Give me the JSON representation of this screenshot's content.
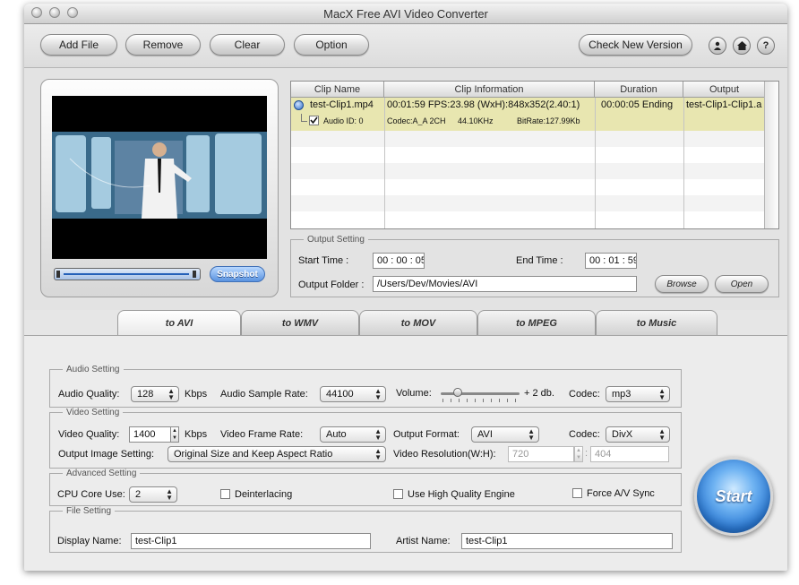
{
  "window": {
    "title": "MacX Free AVI Video Converter"
  },
  "toolbar": {
    "add_file": "Add File",
    "remove": "Remove",
    "clear": "Clear",
    "option": "Option",
    "check_version": "Check New Version",
    "icons": [
      "user-icon",
      "home-icon",
      "help-icon"
    ],
    "help_glyph": "?"
  },
  "preview": {
    "snapshot_label": "Snapshot"
  },
  "clips": {
    "headers": [
      "Clip Name",
      "Clip Information",
      "Duration",
      "Output"
    ],
    "rows": [
      {
        "name": "test-Clip1.mp4",
        "info": "00:01:59  FPS:23.98  (WxH):848x352(2.40:1)",
        "duration": "00:00:05 Ending",
        "output": "test-Clip1-Clip1.a",
        "audio_id": "Audio ID: 0",
        "codec": "Codec:A_A 2CH",
        "freq": "44.10KHz",
        "bitrate": "BitRate:127.99Kb"
      }
    ]
  },
  "output_setting": {
    "legend": "Output Setting",
    "start_label": "Start Time :",
    "start_value": "00 : 00 : 05",
    "end_label": "End Time :",
    "end_value": "00 : 01 : 59",
    "folder_label": "Output Folder :",
    "folder_value": "/Users/Dev/Movies/AVI",
    "browse": "Browse",
    "open": "Open"
  },
  "tabs": [
    "to AVI",
    "to WMV",
    "to MOV",
    "to MPEG",
    "to Music"
  ],
  "audio": {
    "legend": "Audio Setting",
    "quality_label": "Audio Quality:",
    "quality_value": "128",
    "quality_unit": "Kbps",
    "rate_label": "Audio Sample Rate:",
    "rate_value": "44100",
    "volume_label": "Volume:",
    "volume_value": "+ 2 db.",
    "codec_label": "Codec:",
    "codec_value": "mp3"
  },
  "video": {
    "legend": "Video Setting",
    "quality_label": "Video Quality:",
    "quality_value": "1400",
    "quality_unit": "Kbps",
    "frame_label": "Video Frame Rate:",
    "frame_value": "Auto",
    "format_label": "Output Format:",
    "format_value": "AVI",
    "codec_label": "Codec:",
    "codec_value": "DivX",
    "image_label": "Output Image Setting:",
    "image_value": "Original Size and Keep Aspect Ratio",
    "res_label": "Video Resolution(W:H):",
    "res_w": "720",
    "res_h": "404",
    "res_sep": ":"
  },
  "advanced": {
    "legend": "Advanced Setting",
    "cpu_label": "CPU Core Use:",
    "cpu_value": "2",
    "deinterlacing": "Deinterlacing",
    "hq_engine": "Use High Quality Engine",
    "force_sync": "Force A/V Sync"
  },
  "file": {
    "legend": "File Setting",
    "display_label": "Display Name:",
    "display_value": "test-Clip1",
    "artist_label": "Artist Name:",
    "artist_value": "test-Clip1"
  },
  "start_label": "Start",
  "colors": {
    "accent": "#2a78d3",
    "selected_row": "#e8e6b0"
  }
}
